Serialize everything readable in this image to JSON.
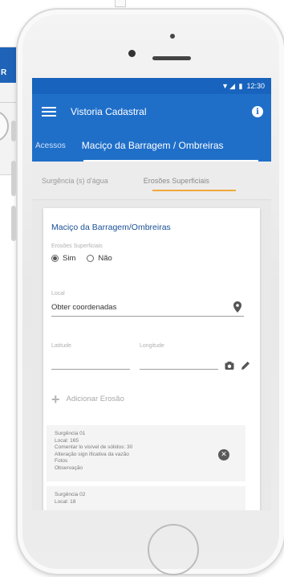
{
  "background_window": {
    "button_label": "R"
  },
  "status_bar": {
    "time": "12:30",
    "icons": "▼◢ ▮"
  },
  "app_bar": {
    "title": "Vistoria Cadastral",
    "info_icon": "i"
  },
  "breadcrumb": {
    "previous": "Acessos",
    "current": "Maciço da Barragem / Ombreiras"
  },
  "subtabs": [
    {
      "label": "Surgência (s) d'água"
    },
    {
      "label": "Erosões Superficiais"
    }
  ],
  "form": {
    "title": "Maciço da Barragem/Ombreiras",
    "erosion_question_label": "Erosões Superficiais",
    "radio_options": [
      {
        "label": "Sim",
        "selected": true
      },
      {
        "label": "Não",
        "selected": false
      }
    ],
    "local_label": "Local",
    "local_value": "Obter coordenadas",
    "latitude_label": "Latitude",
    "longitude_label": "Longitude",
    "add_button_label": "Adicionar Erosão"
  },
  "entries": [
    {
      "lines": [
        "Surgência 01",
        "Local: 165",
        "Comentar lo visível de sólidos: 30",
        "Alteração sign ificativa da vazão",
        "Fotos",
        "Observação"
      ]
    },
    {
      "lines": [
        "Surgência 02",
        "Local: 18"
      ]
    }
  ],
  "icons": {
    "menu": "hamburger-icon",
    "info": "info-icon",
    "location": "map-pin-icon",
    "camera": "camera-icon",
    "edit": "pencil-icon",
    "add": "plus-icon",
    "remove": "close-circle-icon"
  },
  "colors": {
    "primary": "#1f6fc9",
    "status_bar": "#1763bd",
    "tab_indicator": "#f0a93a",
    "card_title": "#1a4f97"
  }
}
